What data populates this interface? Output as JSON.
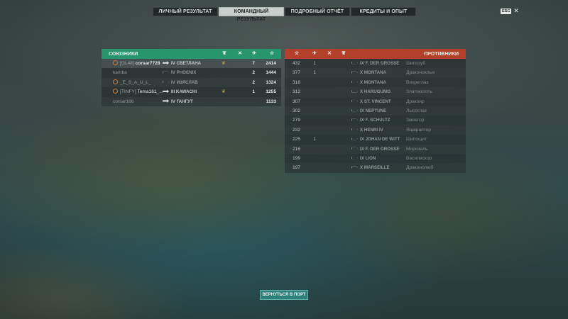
{
  "tabs": [
    {
      "label": "ЛИЧНЫЙ РЕЗУЛЬТАТ",
      "active": false
    },
    {
      "label": "КОМАНДНЫЙ РЕЗУЛЬТАТ",
      "active": true
    },
    {
      "label": "ПОДРОБНЫЙ ОТЧЁТ",
      "active": false
    },
    {
      "label": "КРЕДИТЫ И ОПЫТ",
      "active": false
    }
  ],
  "close": {
    "key": "ESC",
    "icon": "close-icon"
  },
  "allies": {
    "title": "СОЮЗНИКИ",
    "header_icons": [
      "laurel-icon",
      "crossed-swords-icon",
      "plane-icon",
      "star-icon"
    ],
    "rows": [
      {
        "medal": true,
        "clan": "[GL48]",
        "name": "corsar7728",
        "ship_icon": "filled",
        "ship": "IV СВЕТЛАНА",
        "wreath": true,
        "kills": "7",
        "base_xp": "2414",
        "highlight": true
      },
      {
        "medal": false,
        "clan": "",
        "name": "kamba",
        "ship_icon": "outline",
        "ship": "IV PHOENIX",
        "wreath": false,
        "kills": "2",
        "base_xp": "1444",
        "highlight": false
      },
      {
        "medal": true,
        "clan": "",
        "name": "_E_S_A_U_L_",
        "ship_icon": "outline",
        "ship": "IV ИЗЯСЛАВ",
        "wreath": false,
        "kills": "2",
        "base_xp": "1324",
        "highlight": false
      },
      {
        "medal": true,
        "clan": "[TINFY]",
        "name": "Tema161_...",
        "ship_icon": "filled",
        "ship": "III KAWACHI",
        "wreath": true,
        "kills": "1",
        "base_xp": "1255",
        "highlight": false
      },
      {
        "medal": false,
        "clan": "",
        "name": "corsar166",
        "ship_icon": "filled",
        "ship": "IV ГАНГУТ",
        "wreath": false,
        "kills": "",
        "base_xp": "1133",
        "highlight": false
      }
    ]
  },
  "enemies": {
    "title": "ПРОТИВНИКИ",
    "header_icons": [
      "star-icon",
      "plane-icon",
      "crossed-swords-icon",
      "laurel-icon"
    ],
    "rows": [
      {
        "xp": "432",
        "planes": "1",
        "ship": "IX F. DER GROSSE",
        "name": "Шипозуб"
      },
      {
        "xp": "377",
        "planes": "1",
        "ship": "X MONTANA",
        "name": "Драконоклык"
      },
      {
        "xp": "318",
        "planes": "",
        "ship": "X MONTANA",
        "name": "Вихреглаз"
      },
      {
        "xp": "312",
        "planes": "",
        "ship": "X HARUGUMO",
        "name": "Златокоготь"
      },
      {
        "xp": "307",
        "planes": "",
        "ship": "X ST. VINCENT",
        "name": "Дракояр"
      },
      {
        "xp": "302",
        "planes": "",
        "ship": "IX NEPTUNE",
        "name": "Лысоглаз"
      },
      {
        "xp": "279",
        "planes": "",
        "ship": "IX F. SCHULTZ",
        "name": "Змеегор"
      },
      {
        "xp": "232",
        "planes": "",
        "ship": "X HENRI IV",
        "name": "Ящераптор"
      },
      {
        "xp": "225",
        "planes": "1",
        "ship": "IX JOHAN DE WITT",
        "name": "Шипощит"
      },
      {
        "xp": "216",
        "planes": "",
        "ship": "IX F. DER GROSSE",
        "name": "Морозаль"
      },
      {
        "xp": "199",
        "planes": "",
        "ship": "IX LION",
        "name": "Василискор"
      },
      {
        "xp": "197",
        "planes": "",
        "ship": "X MARSEILLE",
        "name": "Драконолюб"
      }
    ]
  },
  "back_button": "ВЕРНУТЬСЯ В ПОРТ"
}
